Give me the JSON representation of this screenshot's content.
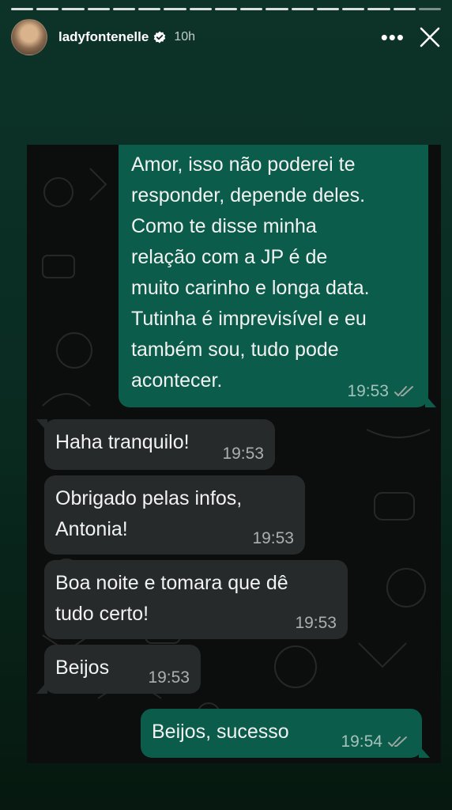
{
  "story": {
    "username": "ladyfontenelle",
    "time_ago": "10h",
    "more_label": "•••",
    "segments": 17
  },
  "messages": [
    {
      "dir": "out",
      "text": "Amor, isso não poderei te\nresponder, depende deles.\nComo te disse minha\nrelação com a JP é de\nmuito carinho e longa data.\nTutinha é imprevisível e eu\ntambém sou, tudo pode\nacontecer.",
      "time": "19:53",
      "read": true
    },
    {
      "dir": "in",
      "text": "Haha tranquilo!",
      "time": "19:53"
    },
    {
      "dir": "in",
      "text": "Obrigado pelas infos,\nAntonia!",
      "time": "19:53"
    },
    {
      "dir": "in",
      "text": "Boa noite e tomara que dê\ntudo certo!",
      "time": "19:53"
    },
    {
      "dir": "in",
      "text": "Beijos",
      "time": "19:53"
    },
    {
      "dir": "out",
      "text": "Beijos, sucesso",
      "time": "19:54",
      "read": true
    }
  ],
  "colors": {
    "outgoing_bubble": "#0b5c4a",
    "incoming_bubble": "#262a2b",
    "chat_background": "#0b0e0d",
    "story_background": "#0a2c22",
    "read_ticks": "#9aa5a1"
  }
}
